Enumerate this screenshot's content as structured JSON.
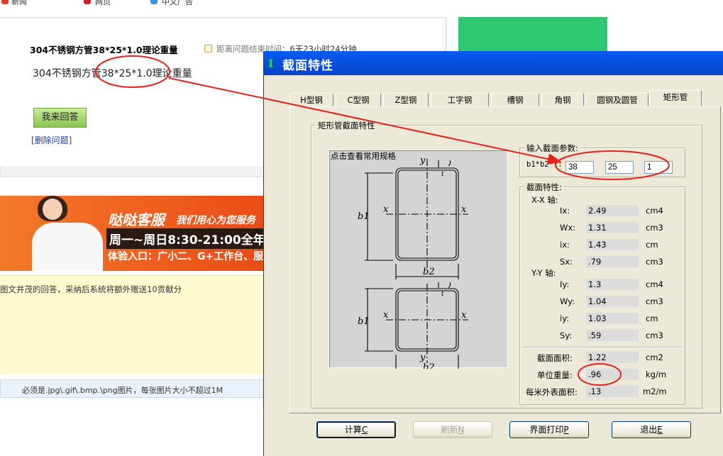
{
  "top_nav": {
    "items": [
      "新闻",
      "网页",
      "中文广告"
    ]
  },
  "question": {
    "title": "304不锈钢方管38*25*1.0理论重量",
    "time_label": "距离问题结束时间：",
    "time_value": "6天23小时24分钟",
    "body": "304不锈钢方管38*25*1.0理论重量",
    "answer_button": "我来回答",
    "delete_link": "[删除问题]"
  },
  "banner": {
    "brand": "哒哒客服",
    "slogan": "我们用心为您服务",
    "hours": "周一~周日8:30-21:00全年",
    "entry": "体验入口：广小二、G+工作台、服"
  },
  "answer_tip": "图文并茂的回答，采纳后系统将额外赠送10贡献分",
  "upload_note": "必须是.jpg\\.gif\\.bmp.\\png图片，每张图片大小不超过1M",
  "dialog": {
    "title": "截面特性",
    "tabs": [
      "H型钢",
      "C型钢",
      "Z型钢",
      "工字钢",
      "槽钢",
      "角钢",
      "圆钢及圆管",
      "矩形管"
    ],
    "active_tab": "矩形管",
    "group_title": "矩形管截面特性",
    "diagram_hint": "点击查看常用规格",
    "diagram_labels": {
      "y": "y",
      "x": "x",
      "b1": "b1",
      "b2": "b2",
      "t": "t"
    },
    "input_group": "输入截面参数:",
    "input_label": "b1*b2*t:",
    "inputs": {
      "b1": "38",
      "b2": "25",
      "t": "1"
    },
    "props_group": "截面特性:",
    "xx_axis": "X-X 轴:",
    "yy_axis": "Y-Y 轴:",
    "xx_props": [
      {
        "name": "Ix:",
        "value": "2.49",
        "unit": "cm4"
      },
      {
        "name": "Wx:",
        "value": "1.31",
        "unit": "cm3"
      },
      {
        "name": "ix:",
        "value": "1.43",
        "unit": "cm"
      },
      {
        "name": "Sx:",
        "value": ".79",
        "unit": "cm3"
      }
    ],
    "yy_props": [
      {
        "name": "Iy:",
        "value": "1.3",
        "unit": "cm4"
      },
      {
        "name": "Wy:",
        "value": "1.04",
        "unit": "cm3"
      },
      {
        "name": "iy:",
        "value": "1.03",
        "unit": "cm"
      },
      {
        "name": "Sy:",
        "value": ".59",
        "unit": "cm3"
      }
    ],
    "area": {
      "name": "截面面积:",
      "value": "1.22",
      "unit": "cm2"
    },
    "weight": {
      "name": "单位重量:",
      "value": ".96",
      "unit": "kg/m"
    },
    "surface": {
      "name": "每米外表面积:",
      "value": ".13",
      "unit": "m2/m"
    },
    "buttons": {
      "calc": "计算",
      "calc_key": "C",
      "refresh": "刷新",
      "refresh_key": "N",
      "print": "界面打印",
      "print_key": "P",
      "exit": "退出",
      "exit_key": "E"
    }
  },
  "annotation_color": "#e8211c"
}
